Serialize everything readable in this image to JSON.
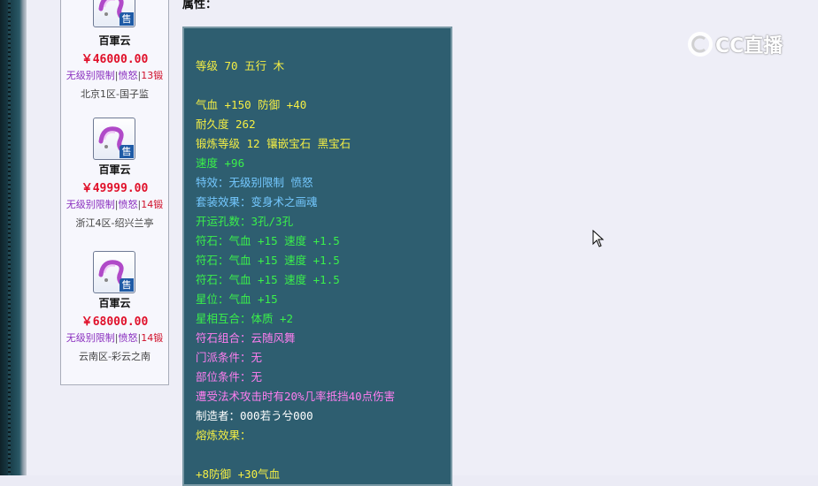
{
  "watermark": {
    "text": "CC直播"
  },
  "listing": {
    "items": [
      {
        "name": "百軍云",
        "price": "￥46000.00",
        "tag1": "无级别限制",
        "tag2": "愤怒",
        "tag3": "13锻",
        "server": "北京1区-国子监",
        "badge": "售"
      },
      {
        "name": "百軍云",
        "price": "￥49999.00",
        "tag1": "无级别限制",
        "tag2": "愤怒",
        "tag3": "14锻",
        "server": "浙江4区-绍兴兰亭",
        "badge": "售"
      },
      {
        "name": "百軍云",
        "price": "￥68000.00",
        "tag1": "无级别限制",
        "tag2": "愤怒",
        "tag3": "14锻",
        "server": "云南区-彩云之南",
        "badge": "售"
      }
    ],
    "separator": "|"
  },
  "attributes": {
    "heading": "属性：",
    "lines": [
      "等级 70 五行 木",
      "气血 +150 防御 +40",
      "耐久度 262",
      "锻炼等级 12 镶嵌宝石 黑宝石",
      "速度 +96",
      "特效：无级别限制 愤怒",
      "套装效果：变身术之画魂",
      "开运孔数：3孔/3孔",
      "符石：气血 +15 速度 +1.5",
      "符石：气血 +15 速度 +1.5",
      "符石：气血 +15 速度 +1.5",
      "星位：气血 +15",
      "星相互合：体质 +2",
      "符石组合：云随风舞",
      "门派条件：无",
      "部位条件：无",
      "遭受法术攻击时有20%几率抵挡40点伤害",
      "制造者：000若う兮000",
      "熔炼效果：",
      "+8防御 +30气血"
    ]
  },
  "colors": {
    "yellow": "#f4ee44",
    "green": "#3af04a",
    "blue": "#74c8ff",
    "pink": "#ff7ef0",
    "white": "#ffffff",
    "price_red": "#e0102a",
    "box_bg": "#2e5e70"
  }
}
